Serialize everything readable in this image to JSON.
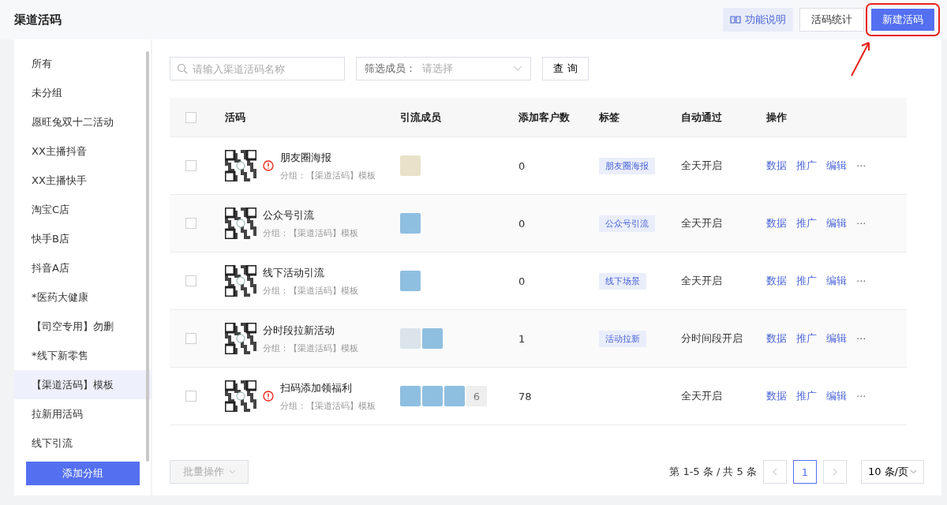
{
  "header": {
    "title": "渠道活码",
    "buttons": [
      {
        "label": "功能说明",
        "kind": "help",
        "highlighted": false
      },
      {
        "label": "活码统计",
        "kind": "default",
        "highlighted": false
      },
      {
        "label": "新建活码",
        "kind": "primary",
        "highlighted": true
      }
    ]
  },
  "sidebar": {
    "items": [
      {
        "label": "所有",
        "selected": false
      },
      {
        "label": "未分组",
        "selected": false
      },
      {
        "label": "愿旺兔双十二活动",
        "selected": false
      },
      {
        "label": "XX主播抖音",
        "selected": false
      },
      {
        "label": "XX主播快手",
        "selected": false
      },
      {
        "label": "淘宝C店",
        "selected": false
      },
      {
        "label": "快手B店",
        "selected": false
      },
      {
        "label": "抖音A店",
        "selected": false
      },
      {
        "label": "*医药大健康",
        "selected": false
      },
      {
        "label": "【司空专用】勿删",
        "selected": false
      },
      {
        "label": "*线下新零售",
        "selected": false
      },
      {
        "label": "【渠道活码】模板",
        "selected": true
      },
      {
        "label": "拉新用活码",
        "selected": false
      },
      {
        "label": "线下引流",
        "selected": false
      }
    ],
    "add_button": "添加分组"
  },
  "filters": {
    "search": {
      "placeholder": "请输入渠道活码名称"
    },
    "member_select": {
      "label": "筛选成员：",
      "placeholder": "请选择"
    },
    "query_button": "查 询"
  },
  "table": {
    "columns": [
      "活码",
      "引流成员",
      "添加客户数",
      "标签",
      "自动通过",
      "操作"
    ],
    "header_checked": false,
    "rows": [
      {
        "checked": false,
        "warning": true,
        "name": "朋友圈海报",
        "group": "分组：【渠道活码】模板",
        "members": [
          {
            "kind": "sticker"
          }
        ],
        "more_count": "",
        "customers": "0",
        "tag": "朋友圈海报",
        "auto_pass": "全天开启",
        "actions": [
          "数据",
          "推广",
          "编辑",
          "···"
        ]
      },
      {
        "checked": false,
        "warning": false,
        "name": "公众号引流",
        "group": "分组：【渠道活码】模板",
        "members": [
          {
            "kind": "photo"
          }
        ],
        "more_count": "",
        "customers": "0",
        "tag": "公众号引流",
        "auto_pass": "全天开启",
        "actions": [
          "数据",
          "推广",
          "编辑",
          "···"
        ]
      },
      {
        "checked": false,
        "warning": false,
        "name": "线下活动引流",
        "group": "分组：【渠道活码】模板",
        "members": [
          {
            "kind": "photo"
          }
        ],
        "more_count": "",
        "customers": "0",
        "tag": "线下场景",
        "auto_pass": "全天开启",
        "actions": [
          "数据",
          "推广",
          "编辑",
          "···"
        ]
      },
      {
        "checked": false,
        "warning": false,
        "name": "分时段拉新活动",
        "group": "分组：【渠道活码】模板",
        "members": [
          {
            "kind": "placeholder"
          },
          {
            "kind": "photo"
          }
        ],
        "more_count": "",
        "customers": "1",
        "tag": "活动拉新",
        "auto_pass": "分时间段开启",
        "actions": [
          "数据",
          "推广",
          "编辑",
          "···"
        ]
      },
      {
        "checked": false,
        "warning": true,
        "name": "扫码添加领福利",
        "group": "分组：【渠道活码】模板",
        "members": [
          {
            "kind": "photo"
          },
          {
            "kind": "photo"
          },
          {
            "kind": "photo"
          }
        ],
        "more_count": "6",
        "customers": "78",
        "tag": "",
        "auto_pass": "全天开启",
        "actions": [
          "数据",
          "推广",
          "编辑",
          "···"
        ]
      }
    ]
  },
  "footer": {
    "batch_button": "批量操作",
    "summary": "第 1-5 条 / 共 5 条",
    "pages": [
      {
        "label": "1",
        "selected": true
      }
    ],
    "page_size": "10 条/页"
  }
}
